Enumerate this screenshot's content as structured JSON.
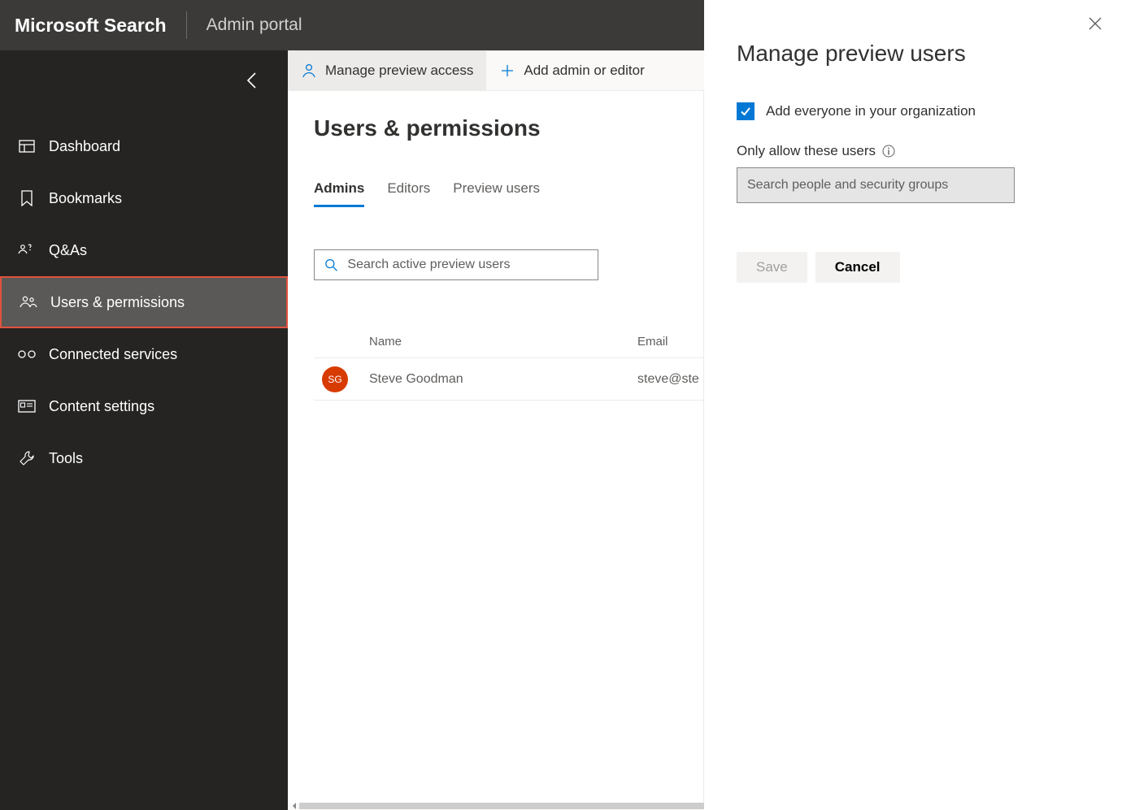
{
  "header": {
    "brand": "Microsoft Search",
    "portal": "Admin portal"
  },
  "sidebar": {
    "items": [
      {
        "label": "Dashboard",
        "icon": "dashboard"
      },
      {
        "label": "Bookmarks",
        "icon": "bookmark"
      },
      {
        "label": "Q&As",
        "icon": "qa"
      },
      {
        "label": "Users & permissions",
        "icon": "people",
        "active": true
      },
      {
        "label": "Connected services",
        "icon": "link"
      },
      {
        "label": "Content settings",
        "icon": "card"
      },
      {
        "label": "Tools",
        "icon": "wrench"
      }
    ]
  },
  "commandBar": {
    "manage_preview": "Manage preview access",
    "add_admin": "Add admin or editor"
  },
  "page": {
    "title": "Users & permissions",
    "tabs": [
      {
        "label": "Admins",
        "active": true
      },
      {
        "label": "Editors"
      },
      {
        "label": "Preview users"
      }
    ],
    "search_placeholder": "Search active preview users",
    "columns": {
      "name": "Name",
      "email": "Email"
    },
    "rows": [
      {
        "initials": "SG",
        "name": "Steve Goodman",
        "email": "steve@ste"
      }
    ]
  },
  "panel": {
    "title": "Manage preview users",
    "checkbox_label": "Add everyone in your organization",
    "checkbox_checked": true,
    "only_allow_label": "Only allow these users",
    "people_placeholder": "Search people and security groups",
    "save": "Save",
    "cancel": "Cancel"
  },
  "colors": {
    "accent": "#0078d4",
    "highlight": "#e1523e",
    "avatar": "#d83b01"
  }
}
